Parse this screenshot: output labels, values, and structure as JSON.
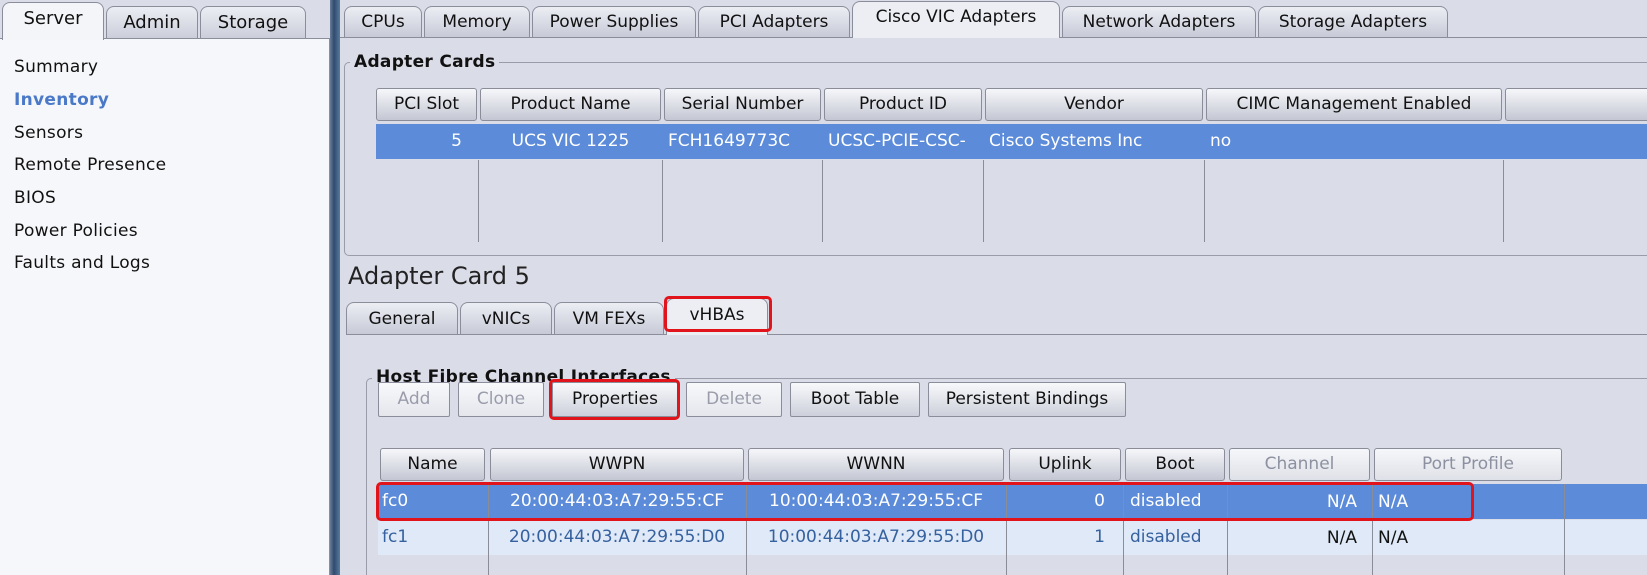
{
  "left_tabs": [
    "Server",
    "Admin",
    "Storage"
  ],
  "nav_items": [
    "Summary",
    "Inventory",
    "Sensors",
    "Remote Presence",
    "BIOS",
    "Power Policies",
    "Faults and Logs"
  ],
  "top_tabs": [
    "CPUs",
    "Memory",
    "Power Supplies",
    "PCI Adapters",
    "Cisco VIC Adapters",
    "Network Adapters",
    "Storage Adapters"
  ],
  "adapter_cards": {
    "legend": "Adapter Cards",
    "columns": [
      "PCI Slot",
      "Product Name",
      "Serial Number",
      "Product ID",
      "Vendor",
      "CIMC Management Enabled"
    ],
    "rows": [
      {
        "pci_slot": "5",
        "product_name": "UCS VIC 1225",
        "serial_number": "FCH1649773C",
        "product_id": "UCSC-PCIE-CSC-",
        "vendor": "Cisco Systems Inc",
        "cimc": "no"
      }
    ]
  },
  "section_title": "Adapter Card 5",
  "sub_tabs": [
    "General",
    "vNICs",
    "VM FEXs",
    "vHBAs"
  ],
  "hfci": {
    "legend": "Host Fibre Channel Interfaces",
    "buttons": [
      "Add",
      "Clone",
      "Properties",
      "Delete",
      "Boot Table",
      "Persistent Bindings"
    ],
    "columns": [
      "Name",
      "WWPN",
      "WWNN",
      "Uplink",
      "Boot",
      "Channel",
      "Port Profile"
    ],
    "rows": [
      {
        "name": "fc0",
        "wwpn": "20:00:44:03:A7:29:55:CF",
        "wwnn": "10:00:44:03:A7:29:55:CF",
        "uplink": "0",
        "boot": "disabled",
        "channel": "N/A",
        "port_profile": "N/A"
      },
      {
        "name": "fc1",
        "wwpn": "20:00:44:03:A7:29:55:D0",
        "wwnn": "10:00:44:03:A7:29:55:D0",
        "uplink": "1",
        "boot": "disabled",
        "channel": "N/A",
        "port_profile": "N/A"
      }
    ]
  },
  "colors": {
    "selected_row": "#5b8bd9",
    "highlight": "#e2141b",
    "active_nav": "#4a79c8"
  }
}
